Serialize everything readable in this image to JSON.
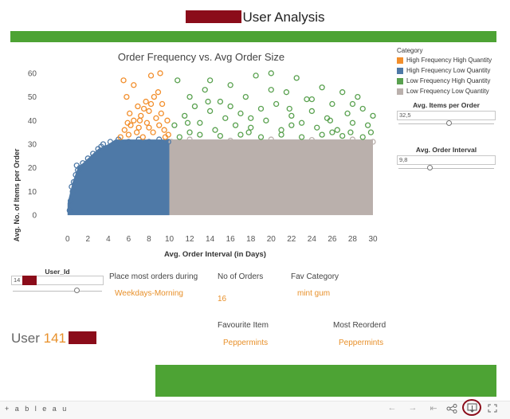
{
  "dashboard": {
    "title_suffix": "User Analysis"
  },
  "colors": {
    "high_freq_high_qty": "#f28e2b",
    "high_freq_low_qty": "#4e79a7",
    "low_freq_high_qty": "#59a14f",
    "low_freq_low_qty": "#bab0ac",
    "accent_green": "#4da334",
    "value_orange": "#e8902a",
    "redaction": "#8b0c1a"
  },
  "legend": {
    "title": "Category",
    "items": [
      {
        "label": "High Frequency High Quantity",
        "color": "#f28e2b"
      },
      {
        "label": "High Frequency Low Quantity",
        "color": "#4e79a7"
      },
      {
        "label": "Low Frequency High Quantity",
        "color": "#59a14f"
      },
      {
        "label": "Low Frequency Low Quantity",
        "color": "#bab0ac"
      }
    ]
  },
  "filters": {
    "avg_items": {
      "label": "Avg. Items per Order",
      "value": "32,5",
      "level": 0.53
    },
    "avg_interval": {
      "label": "Avg. Order Interval",
      "value": "9,8",
      "level": 0.33
    },
    "user_id": {
      "label": "User_Id",
      "value": "14",
      "level": 0.72
    }
  },
  "summary": {
    "place_label": "Place most orders during",
    "place_value": "Weekdays-Morning",
    "orders_label": "No of Orders",
    "orders_value": "16",
    "fav_category_label": "Fav Category",
    "fav_category_value": "mint gum",
    "fav_item_label": "Favourite Item",
    "fav_item_value": "Peppermints",
    "most_reordered_label": "Most Reorderd",
    "most_reordered_value": "Peppermints",
    "user_prefix": "User",
    "user_number": "141"
  },
  "toolbar": {
    "logo_text": "+ a b l e a u",
    "icons": [
      "undo-icon",
      "redo-icon",
      "revert-icon",
      "share-icon",
      "download-icon",
      "fullscreen-icon"
    ]
  },
  "chart_data": {
    "type": "scatter",
    "title": "Order Frequency vs. Avg Order Size",
    "xlabel": "Avg. Order Interval (in Days)",
    "ylabel": "Avg. No. of Items per Order",
    "xlim": [
      -1,
      30
    ],
    "ylim": [
      -2,
      62
    ],
    "x_ticks": [
      0,
      2,
      4,
      6,
      8,
      10,
      12,
      14,
      16,
      18,
      20,
      22,
      24,
      26,
      28,
      30
    ],
    "y_ticks": [
      0,
      10,
      20,
      30,
      40,
      50,
      60
    ],
    "grid": false,
    "legend_position": "right",
    "series": [
      {
        "name": "Low Frequency Low Quantity",
        "color": "#bab0ac",
        "x_range": [
          10,
          30
        ],
        "y_range": [
          0,
          32
        ],
        "filled_region": true,
        "points": [
          [
            10.2,
            31
          ],
          [
            12,
            32
          ],
          [
            16,
            31.5
          ],
          [
            20,
            32
          ],
          [
            24,
            31.8
          ],
          [
            28,
            32
          ],
          [
            30,
            31
          ],
          [
            15,
            5
          ],
          [
            25,
            2
          ]
        ]
      },
      {
        "name": "High Frequency Low Quantity",
        "color": "#4e79a7",
        "x_range": [
          0,
          10
        ],
        "y_range": [
          0,
          32
        ],
        "filled_region": true,
        "points": [
          [
            0.2,
            2
          ],
          [
            0.3,
            6
          ],
          [
            0.5,
            10
          ],
          [
            0.6,
            14
          ],
          [
            0.8,
            17
          ],
          [
            1.0,
            19
          ],
          [
            0.9,
            21
          ],
          [
            1.5,
            22
          ],
          [
            2,
            24
          ],
          [
            2.5,
            26
          ],
          [
            3,
            28
          ],
          [
            3.3,
            29
          ],
          [
            3.5,
            30
          ],
          [
            4.2,
            31
          ],
          [
            4.8,
            30
          ],
          [
            5,
            32
          ],
          [
            6,
            31
          ],
          [
            7,
            32
          ],
          [
            8,
            31
          ],
          [
            9,
            32
          ],
          [
            9.9,
            31
          ],
          [
            1.2,
            20
          ],
          [
            0.4,
            12
          ]
        ]
      },
      {
        "name": "High Frequency High Quantity",
        "color": "#f28e2b",
        "points": [
          [
            5.2,
            33
          ],
          [
            5.6,
            36
          ],
          [
            6,
            34
          ],
          [
            6.2,
            38
          ],
          [
            6.5,
            40
          ],
          [
            6.8,
            35
          ],
          [
            7,
            37
          ],
          [
            7.2,
            42
          ],
          [
            7.5,
            45
          ],
          [
            7.8,
            39
          ],
          [
            8,
            44
          ],
          [
            8.2,
            47
          ],
          [
            8.5,
            50
          ],
          [
            8.7,
            41
          ],
          [
            9,
            38
          ],
          [
            9.2,
            43
          ],
          [
            9.5,
            36
          ],
          [
            9.8,
            40
          ],
          [
            9.9,
            34
          ],
          [
            5.8,
            50
          ],
          [
            5.5,
            57
          ],
          [
            6.5,
            55
          ],
          [
            8.2,
            59
          ],
          [
            9.1,
            60
          ],
          [
            7.7,
            48
          ],
          [
            6.9,
            46
          ],
          [
            8.9,
            52
          ],
          [
            7.4,
            33
          ],
          [
            8.4,
            35
          ],
          [
            9.6,
            33
          ],
          [
            6.1,
            43
          ],
          [
            5.9,
            39
          ],
          [
            8.0,
            37
          ],
          [
            9.3,
            47
          ],
          [
            7.1,
            40
          ]
        ]
      },
      {
        "name": "Low Frequency High Quantity",
        "color": "#59a14f",
        "points": [
          [
            10.5,
            38
          ],
          [
            10.8,
            57
          ],
          [
            11.5,
            42
          ],
          [
            12,
            35
          ],
          [
            12.5,
            46
          ],
          [
            13,
            39
          ],
          [
            13.5,
            53
          ],
          [
            14,
            44
          ],
          [
            14.5,
            36
          ],
          [
            15,
            48
          ],
          [
            15.5,
            41
          ],
          [
            16,
            55
          ],
          [
            16.5,
            38
          ],
          [
            17,
            43
          ],
          [
            17.5,
            50
          ],
          [
            18,
            37
          ],
          [
            18.5,
            59
          ],
          [
            19,
            45
          ],
          [
            19.5,
            40
          ],
          [
            20,
            60
          ],
          [
            20.5,
            47
          ],
          [
            21,
            36
          ],
          [
            21.5,
            52
          ],
          [
            22,
            42
          ],
          [
            22.5,
            58
          ],
          [
            23,
            39
          ],
          [
            23.5,
            49
          ],
          [
            24,
            44
          ],
          [
            24.5,
            37
          ],
          [
            25,
            54
          ],
          [
            25.5,
            41
          ],
          [
            26,
            47
          ],
          [
            26.5,
            36
          ],
          [
            27,
            52
          ],
          [
            27.5,
            43
          ],
          [
            28,
            39
          ],
          [
            28.5,
            50
          ],
          [
            29,
            45
          ],
          [
            29.5,
            38
          ],
          [
            30,
            42
          ],
          [
            11,
            33
          ],
          [
            13,
            34
          ],
          [
            15,
            33.5
          ],
          [
            17,
            34
          ],
          [
            19,
            33
          ],
          [
            21,
            34
          ],
          [
            23,
            33
          ],
          [
            25,
            34
          ],
          [
            27,
            33.5
          ],
          [
            29,
            33
          ],
          [
            12,
            50
          ],
          [
            16,
            46
          ],
          [
            20,
            53
          ],
          [
            24,
            49
          ],
          [
            28,
            47
          ],
          [
            18,
            41
          ],
          [
            22,
            38
          ],
          [
            26,
            35
          ],
          [
            14,
            57
          ],
          [
            29.8,
            35
          ],
          [
            11.8,
            39
          ],
          [
            13.8,
            48
          ],
          [
            17.8,
            35
          ],
          [
            21.8,
            45
          ],
          [
            25.8,
            40
          ],
          [
            27.8,
            35
          ]
        ]
      }
    ]
  }
}
